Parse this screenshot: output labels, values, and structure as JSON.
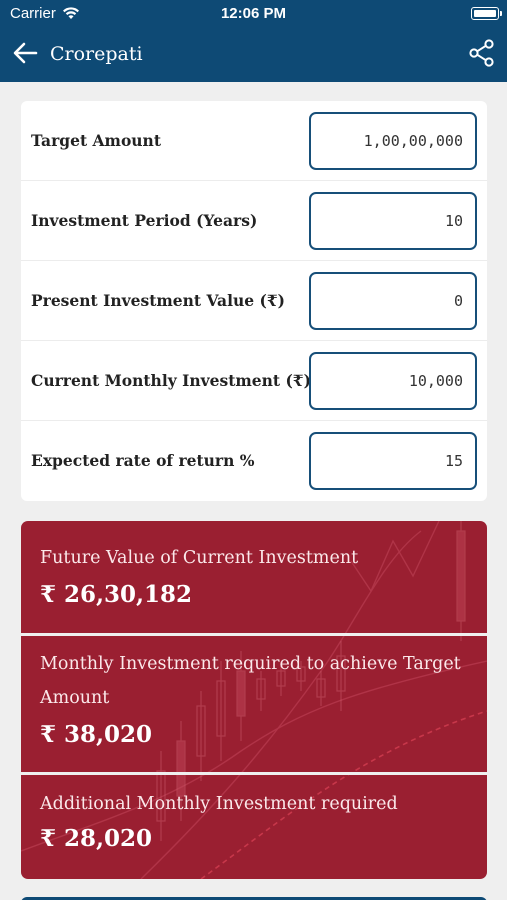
{
  "status_bar": {
    "carrier": "Carrier",
    "time": "12:06 PM"
  },
  "header": {
    "title": "Crorepati",
    "back_icon": "arrow-left-icon",
    "share_icon": "share-icon"
  },
  "form": {
    "rows": [
      {
        "label": "Target Amount",
        "value": "1,00,00,000"
      },
      {
        "label": "Investment Period (Years)",
        "value": "10"
      },
      {
        "label": "Present Investment Value (₹)",
        "value": "0"
      },
      {
        "label": "Current Monthly Investment (₹)",
        "value": "10,000"
      },
      {
        "label": "Expected rate of return %",
        "value": "15"
      }
    ]
  },
  "results": {
    "future_value": {
      "label": "Future Value of Current Investment",
      "value": "₹ 26,30,182"
    },
    "monthly_required": {
      "label_line1": "Monthly Investment required to achieve Target",
      "label_line2": "Amount",
      "value": "₹ 38,020"
    },
    "additional_monthly": {
      "label": "Additional Monthly Investment required",
      "value": "₹ 28,020"
    }
  },
  "colors": {
    "header": "#0e4a75",
    "result_card": "#9a1f31",
    "input_border": "#174f79"
  }
}
